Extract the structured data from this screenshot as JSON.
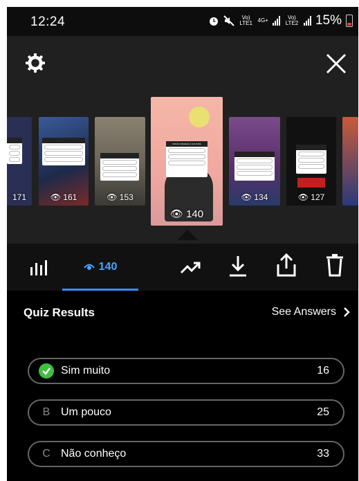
{
  "status_bar": {
    "time": "12:24",
    "sim1_label": "Vo) LTE1",
    "network_label": "4G+",
    "sim2_label": "Vo) LTE2",
    "battery": "15%"
  },
  "header": {
    "settings_icon": "gear-icon",
    "close_icon": "close-icon"
  },
  "stories": [
    {
      "views": "171",
      "bg": "#2a2f55"
    },
    {
      "views": "161",
      "bg": "#1d2a4a"
    },
    {
      "views": "153",
      "bg": "#6b655a"
    },
    {
      "views": "140",
      "bg": "#f4b7a7",
      "selected": true
    },
    {
      "views": "134",
      "bg": "#5a2f6b"
    },
    {
      "views": "127",
      "bg": "#111111"
    },
    {
      "views": "",
      "bg": "#c85b3a"
    }
  ],
  "selected_story": {
    "question": "VOCÊ CONHECE A CULTURA CYBERPUNK?",
    "options": [
      "Sim muito",
      "Um pouco",
      "Não conheço"
    ]
  },
  "tabs": {
    "insights_icon": "bar-chart-icon",
    "views_count": "140",
    "trending_icon": "trending-up-icon",
    "download_icon": "download-icon",
    "share_icon": "share-icon",
    "delete_icon": "trash-icon"
  },
  "quiz": {
    "title": "Quiz Results",
    "see_answers": "See Answers",
    "answers": [
      {
        "mark": "",
        "label": "Sim muito",
        "count": "16",
        "correct": true
      },
      {
        "mark": "B",
        "label": "Um pouco",
        "count": "25",
        "correct": false
      },
      {
        "mark": "C",
        "label": "Não conheço",
        "count": "33",
        "correct": false
      }
    ]
  },
  "colors": {
    "accent": "#3d8eff",
    "correct": "#3fbf3f"
  }
}
